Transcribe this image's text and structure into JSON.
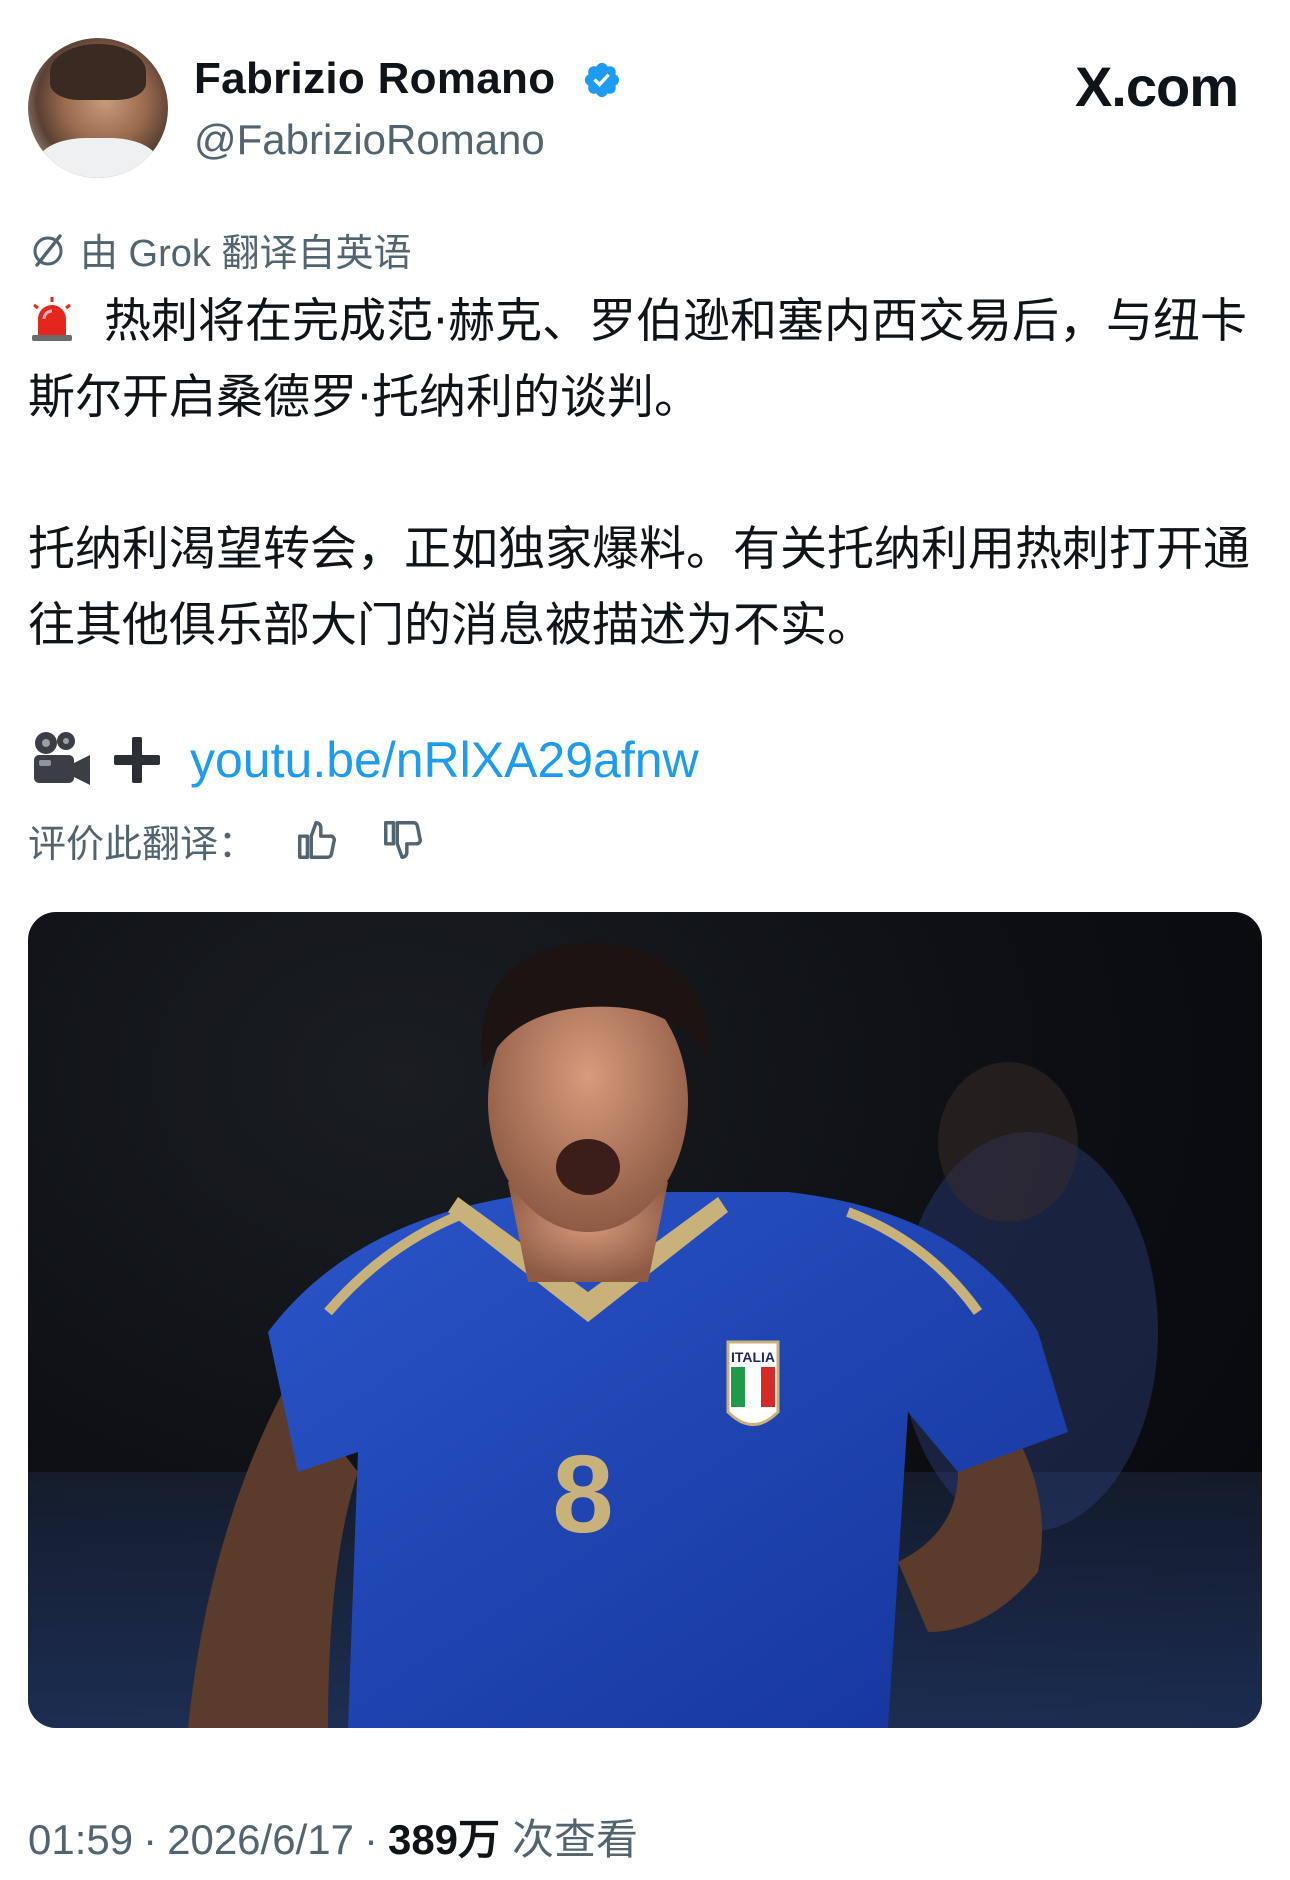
{
  "author": {
    "display_name": "Fabrizio Romano",
    "handle": "@FabrizioRomano",
    "verified": true
  },
  "brand": {
    "logo_text": "X.com"
  },
  "translation": {
    "label": "由 Grok 翻译自英语",
    "rate_label": "评价此翻译："
  },
  "tweet": {
    "paragraph_1": "热刺将在完成范·赫克、罗伯逊和塞内西交易后，与纽卡斯尔开启桑德罗·托纳利的谈判。",
    "paragraph_2": "托纳利渴望转会，正如独家爆料。有关托纳利用热刺打开通往其他俱乐部大门的消息被描述为不实。",
    "link_text": "youtu.be/nRlXA29afnw",
    "prefix_icons": [
      "siren-icon",
      "movie-camera-icon",
      "plus-icon"
    ]
  },
  "media": {
    "jersey_text": "ITALIA",
    "jersey_number": "8"
  },
  "meta": {
    "time": "01:59",
    "separator": "·",
    "date": "2026/6/17",
    "views_count": "389万",
    "views_label": "次查看"
  },
  "colors": {
    "link": "#1d9bf0",
    "verified": "#1d9bf0",
    "secondary_text": "#536471",
    "primary_text": "#0f1419",
    "jersey_blue": "#1f47b8"
  }
}
